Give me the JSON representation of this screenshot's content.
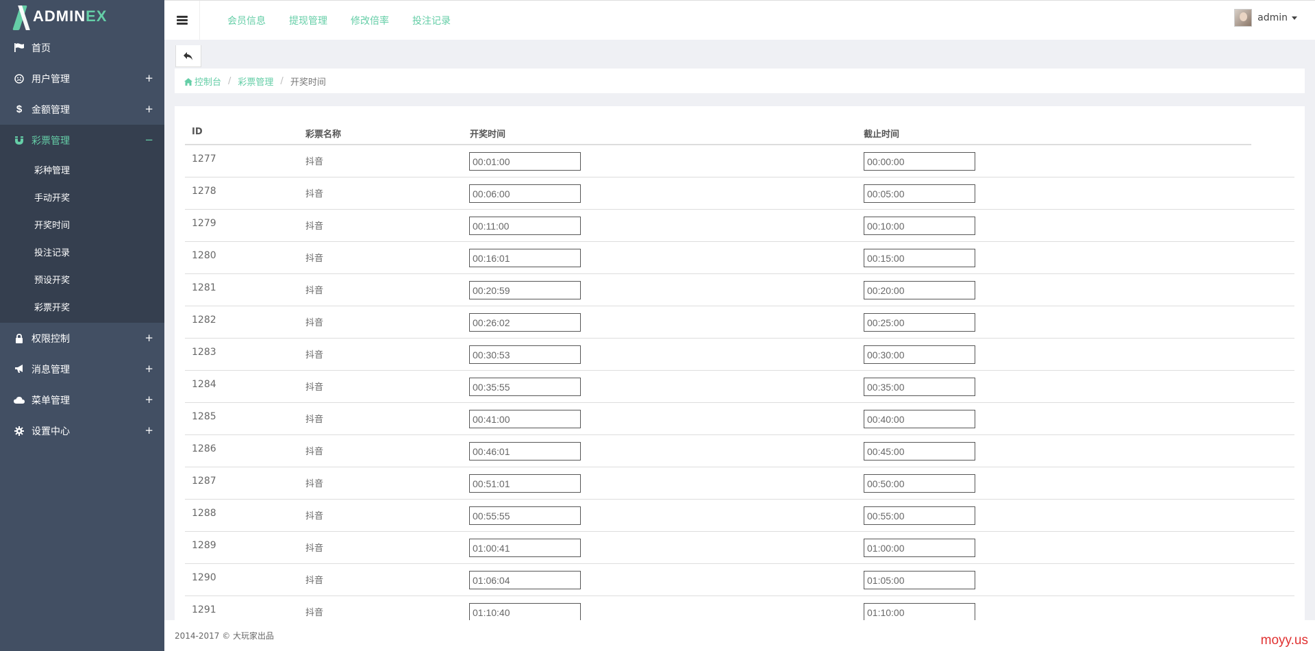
{
  "brand": {
    "prefix": "ADMIN",
    "accent": "EX"
  },
  "sidebar": {
    "items": [
      {
        "label": "首页",
        "icon": "flag-icon",
        "expandable": false
      },
      {
        "label": "用户管理",
        "icon": "user-circle-icon",
        "expandable": true
      },
      {
        "label": "金额管理",
        "icon": "dollar-icon",
        "expandable": true
      },
      {
        "label": "彩票管理",
        "icon": "magnet-icon",
        "expandable": true,
        "active": true
      },
      {
        "label": "权限控制",
        "icon": "lock-icon",
        "expandable": true
      },
      {
        "label": "消息管理",
        "icon": "bullhorn-icon",
        "expandable": true
      },
      {
        "label": "菜单管理",
        "icon": "cloud-icon",
        "expandable": true
      },
      {
        "label": "设置中心",
        "icon": "gear-icon",
        "expandable": true
      }
    ],
    "subitems": [
      "彩种管理",
      "手动开奖",
      "开奖时间",
      "投注记录",
      "预设开奖",
      "彩票开奖"
    ],
    "plus": "+",
    "minus": "−"
  },
  "header": {
    "menu": [
      "会员信息",
      "提现管理",
      "修改倍率",
      "投注记录"
    ],
    "user": "admin"
  },
  "breadcrumb": {
    "home": "控制台",
    "parent": "彩票管理",
    "current": "开奖时间"
  },
  "table": {
    "headers": {
      "id": "ID",
      "name": "彩票名称",
      "open": "开奖时间",
      "close": "截止时间"
    },
    "rows": [
      {
        "id": "1277",
        "name": "抖音",
        "open": "00:01:00",
        "close": "00:00:00"
      },
      {
        "id": "1278",
        "name": "抖音",
        "open": "00:06:00",
        "close": "00:05:00"
      },
      {
        "id": "1279",
        "name": "抖音",
        "open": "00:11:00",
        "close": "00:10:00"
      },
      {
        "id": "1280",
        "name": "抖音",
        "open": "00:16:01",
        "close": "00:15:00"
      },
      {
        "id": "1281",
        "name": "抖音",
        "open": "00:20:59",
        "close": "00:20:00"
      },
      {
        "id": "1282",
        "name": "抖音",
        "open": "00:26:02",
        "close": "00:25:00"
      },
      {
        "id": "1283",
        "name": "抖音",
        "open": "00:30:53",
        "close": "00:30:00"
      },
      {
        "id": "1284",
        "name": "抖音",
        "open": "00:35:55",
        "close": "00:35:00"
      },
      {
        "id": "1285",
        "name": "抖音",
        "open": "00:41:00",
        "close": "00:40:00"
      },
      {
        "id": "1286",
        "name": "抖音",
        "open": "00:46:01",
        "close": "00:45:00"
      },
      {
        "id": "1287",
        "name": "抖音",
        "open": "00:51:01",
        "close": "00:50:00"
      },
      {
        "id": "1288",
        "name": "抖音",
        "open": "00:55:55",
        "close": "00:55:00"
      },
      {
        "id": "1289",
        "name": "抖音",
        "open": "01:00:41",
        "close": "01:00:00"
      },
      {
        "id": "1290",
        "name": "抖音",
        "open": "01:06:04",
        "close": "01:05:00"
      },
      {
        "id": "1291",
        "name": "抖音",
        "open": "01:10:40",
        "close": "01:10:00"
      }
    ]
  },
  "footer": {
    "text": "2014-2017 © 大玩家出品"
  },
  "watermark": "moyy.us",
  "colors": {
    "accent": "#65cea7",
    "sidebar": "#424f63",
    "sidebar_active": "#353f4f",
    "watermark": "#e03131"
  }
}
